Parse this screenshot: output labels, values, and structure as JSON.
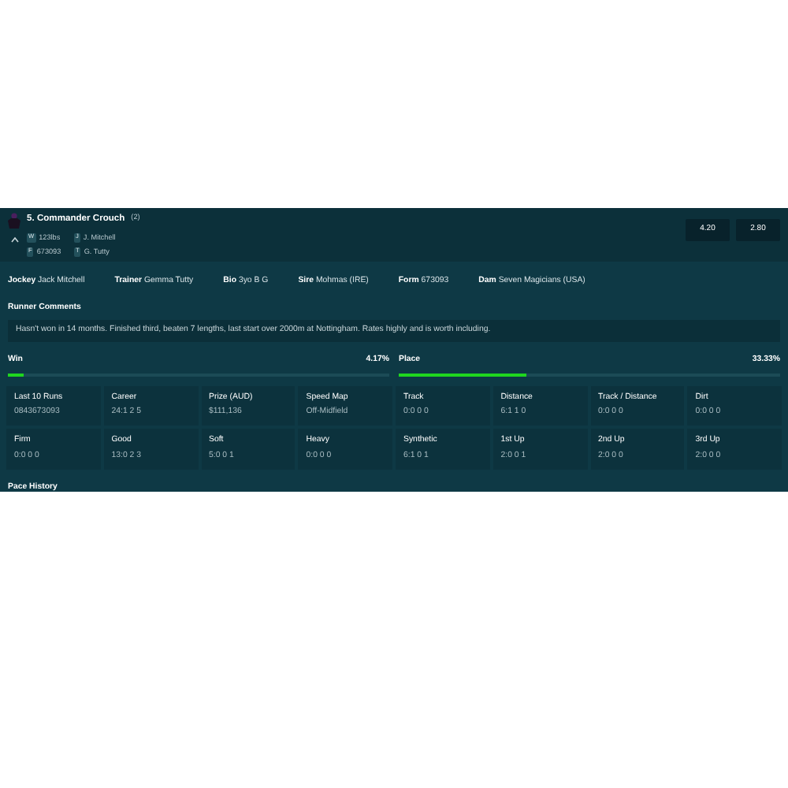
{
  "runner": {
    "title": "5. Commander Crouch",
    "barrier": "(2)",
    "expanded": true,
    "meta": [
      {
        "tag": "W",
        "value": "123lbs"
      },
      {
        "tag": "J",
        "value": "J. Mitchell"
      },
      {
        "tag": "F",
        "value": "673093"
      },
      {
        "tag": "T",
        "value": "G. Tutty"
      }
    ],
    "odds": [
      "4.20",
      "2.80"
    ]
  },
  "details": [
    {
      "label": "Jockey",
      "value": "Jack Mitchell"
    },
    {
      "label": "Trainer",
      "value": "Gemma Tutty"
    },
    {
      "label": "Bio",
      "value": "3yo B G"
    },
    {
      "label": "Sire",
      "value": "Mohmas (IRE)"
    },
    {
      "label": "Form",
      "value": "673093"
    },
    {
      "label": "Dam",
      "value": "Seven Magicians (USA)"
    }
  ],
  "comments": {
    "heading": "Runner Comments",
    "text": "Hasn't won in 14 months. Finished third, beaten 7 lengths, last start over 2000m at Nottingham. Rates highly and is worth including."
  },
  "probabilities": [
    {
      "label": "Win",
      "reading": "4.17%",
      "level": 0.0417
    },
    {
      "label": "Place",
      "reading": "33.33%",
      "level": 0.3333
    }
  ],
  "stats": [
    {
      "label": "Last 10 Runs",
      "value": "0843673093"
    },
    {
      "label": "Career",
      "value": "24:1 2 5"
    },
    {
      "label": "Prize (AUD)",
      "value": "$111,136"
    },
    {
      "label": "Speed Map",
      "value": "Off-Midfield"
    },
    {
      "label": "Track",
      "value": "0:0 0 0"
    },
    {
      "label": "Distance",
      "value": "6:1 1 0"
    },
    {
      "label": "Track / Distance",
      "value": "0:0 0 0"
    },
    {
      "label": "Dirt",
      "value": "0:0 0 0"
    },
    {
      "label": "Firm",
      "value": "0:0 0 0"
    },
    {
      "label": "Good",
      "value": "13:0 2 3"
    },
    {
      "label": "Soft",
      "value": "5:0 0 1"
    },
    {
      "label": "Heavy",
      "value": "0:0 0 0"
    },
    {
      "label": "Synthetic",
      "value": "6:1 0 1"
    },
    {
      "label": "1st Up",
      "value": "2:0 0 1"
    },
    {
      "label": "2nd Up",
      "value": "2:0 0 0"
    },
    {
      "label": "3rd Up",
      "value": "2:0 0 0"
    }
  ],
  "next_section": "Pace History"
}
